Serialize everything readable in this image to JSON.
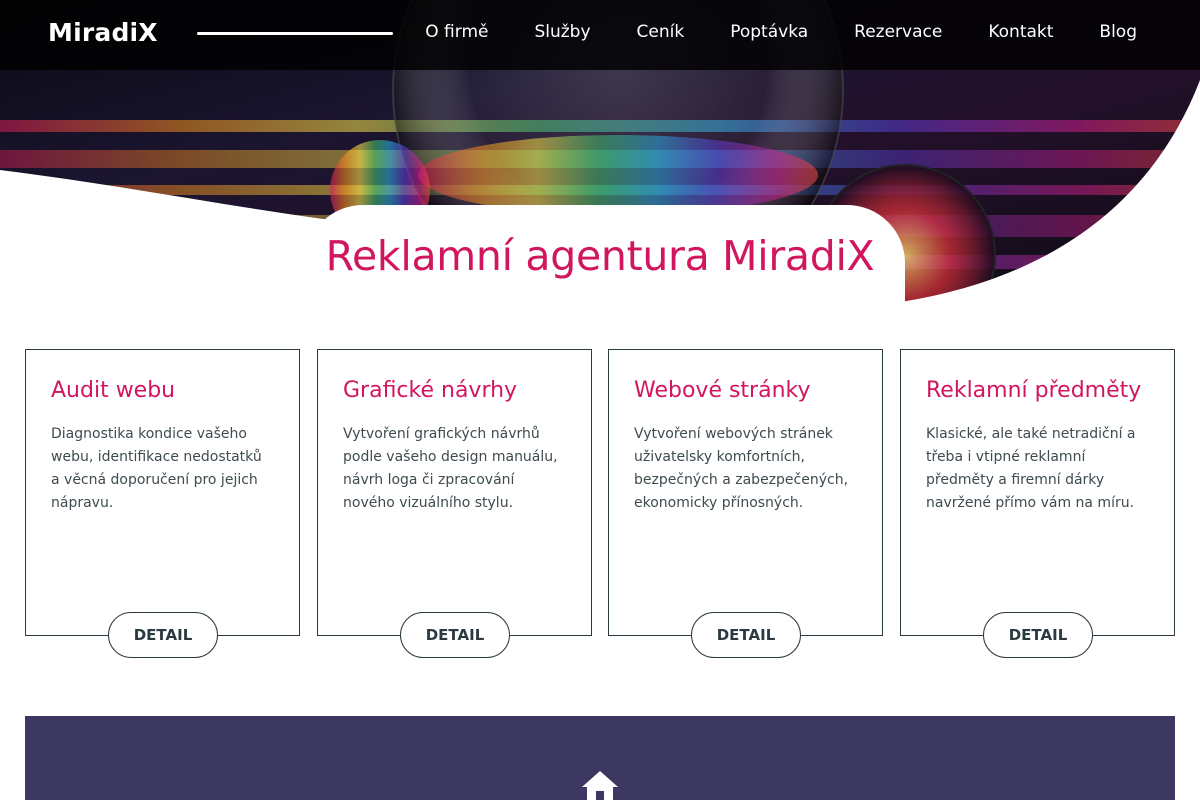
{
  "brand": {
    "name": "MiradiX",
    "accent": "#d1165f",
    "dark": "#2b3a40",
    "panel": "#3c3862"
  },
  "nav": {
    "items": [
      {
        "label": "O firmě"
      },
      {
        "label": "Služby"
      },
      {
        "label": "Ceník"
      },
      {
        "label": "Poptávka"
      },
      {
        "label": "Rezervace"
      },
      {
        "label": "Kontakt"
      },
      {
        "label": "Blog"
      }
    ]
  },
  "hero": {
    "title": "Reklamní agentura MiradiX",
    "image": "glass-spheres-on-colorful-background"
  },
  "cards": [
    {
      "title": "Audit webu",
      "text": "Diagnostika kondice vašeho webu, identifikace nedostatků a věcná doporučení pro jejich nápravu.",
      "button": "DETAIL"
    },
    {
      "title": "Grafické návrhy",
      "text": "Vytvoření grafických návrhů podle vašeho design manuálu, návrh loga či zpracování nového vizuálního stylu.",
      "button": "DETAIL"
    },
    {
      "title": "Webové stránky",
      "text": "Vytvoření webových stránek uživatelsky komfortních, bezpečných a zabezpečených, ekonomicky přínosných.",
      "button": "DETAIL"
    },
    {
      "title": "Reklamní předměty",
      "text": "Klasické, ale také netradiční a třeba i vtipné reklamní předměty a firemní dárky navržené přímo vám na míru.",
      "button": "DETAIL"
    }
  ],
  "footer_section": {
    "icon": "home-icon"
  }
}
